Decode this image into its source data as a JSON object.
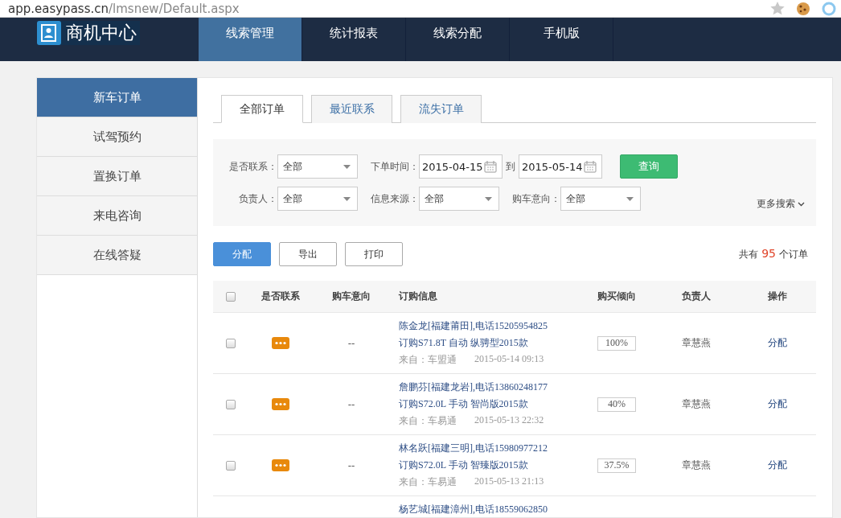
{
  "browser": {
    "url_host": "app.easypass.cn",
    "url_path": "/lmsnew/Default.aspx"
  },
  "header": {
    "logo_text": "商机中心",
    "nav": [
      {
        "label": "线索管理",
        "selected": true
      },
      {
        "label": "统计报表",
        "selected": false
      },
      {
        "label": "线索分配",
        "selected": false
      },
      {
        "label": "手机版",
        "selected": false
      }
    ]
  },
  "sidebar": [
    {
      "label": "新车订单",
      "selected": true
    },
    {
      "label": "试驾预约",
      "selected": false
    },
    {
      "label": "置换订单",
      "selected": false
    },
    {
      "label": "来电咨询",
      "selected": false
    },
    {
      "label": "在线答疑",
      "selected": false
    }
  ],
  "tabs": [
    {
      "label": "全部订单",
      "selected": true
    },
    {
      "label": "最近联系",
      "selected": false
    },
    {
      "label": "流失订单",
      "selected": false
    }
  ],
  "filters": {
    "contact": {
      "label": "是否联系：",
      "value": "全部"
    },
    "order_time": {
      "label": "下单时间：",
      "from": "2015-04-15",
      "separator": "到",
      "to": "2015-05-14"
    },
    "query_button": "查询",
    "row_2": [
      {
        "label": "负责人：",
        "value": "全部"
      },
      {
        "label": "信息来源：",
        "value": "全部"
      },
      {
        "label": "购车意向：",
        "value": "全部"
      }
    ],
    "more_search": "更多搜索"
  },
  "actions": [
    {
      "label": "分配",
      "kind": "primary"
    },
    {
      "label": "导出",
      "kind": "default"
    },
    {
      "label": "打印",
      "kind": "default"
    }
  ],
  "total": {
    "prefix": "共有",
    "count": "95",
    "suffix": "个订单"
  },
  "table": {
    "select_all_checked": false,
    "columns": [
      "是否联系",
      "购车意向",
      "订购信息",
      "购买倾向",
      "负责人",
      "操作"
    ],
    "rows": [
      {
        "checked": false,
        "intent": "--",
        "customer": "陈金龙[福建莆田],电话15205954825",
        "order": "订购S71.8T 自动 纵骋型2015款",
        "source": "来自：车盟通",
        "time": "2015-05-14 09:13",
        "tendency": "100%",
        "owner": "章慧燕",
        "action": "分配"
      },
      {
        "checked": false,
        "intent": "--",
        "customer": "詹鹏芬[福建龙岩],电话13860248177",
        "order": "订购S72.0L 手动 智尚版2015款",
        "source": "来自：车易通",
        "time": "2015-05-13 22:32",
        "tendency": "40%",
        "owner": "章慧燕",
        "action": "分配"
      },
      {
        "checked": false,
        "intent": "--",
        "customer": "林名跃[福建三明],电话15980977212",
        "order": "订购S72.0L 手动 智臻版2015款",
        "source": "来自：车易通",
        "time": "2015-05-13 21:13",
        "tendency": "37.5%",
        "owner": "章慧燕",
        "action": "分配"
      },
      {
        "customer": "杨艺城[福建漳州],电话18559062850"
      }
    ]
  }
}
